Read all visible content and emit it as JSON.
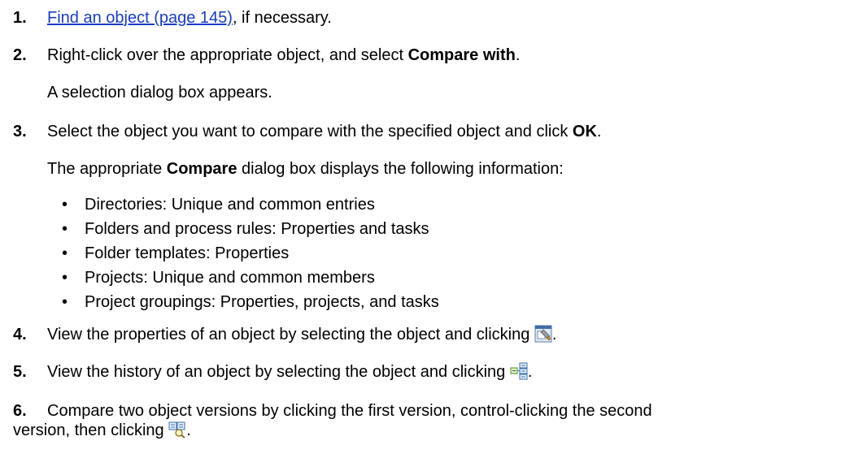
{
  "steps": [
    {
      "number": "1.",
      "link": "Find an object (page 145)",
      "after_link": ", if necessary."
    },
    {
      "number": "2.",
      "text_before": "Right-click over the appropriate object, and select ",
      "bold": "Compare with",
      "text_after": "."
    },
    {
      "note": "A selection dialog box appears."
    },
    {
      "number": "3.",
      "text_before": "Select the object you want to compare with the specified object and click ",
      "bold": "OK",
      "text_after": "."
    },
    {
      "note_before": "The appropriate ",
      "note_bold": "Compare",
      "note_after": " dialog box displays the following information:"
    },
    {
      "number": "4.",
      "text": "View the properties of an object by selecting the object and clicking ",
      "end": ".",
      "icon": "properties-icon"
    },
    {
      "number": "5.",
      "text": "View the history of an object by selecting the object and clicking ",
      "end": ".",
      "icon": "history-icon"
    },
    {
      "number": "6.",
      "line1": "Compare two object versions by clicking the first version, control-clicking the second",
      "line2": "version, then clicking ",
      "end": ".",
      "icon": "compare-versions-icon"
    }
  ],
  "bullets": {
    "marker": "•",
    "items": [
      "Directories: Unique and common entries",
      "Folders and process rules: Properties and tasks",
      "Folder templates: Properties",
      "Projects: Unique and common members",
      "Project groupings: Properties, projects, and tasks"
    ]
  },
  "colors": {
    "link": "#1a3cc8",
    "text": "#000000"
  }
}
